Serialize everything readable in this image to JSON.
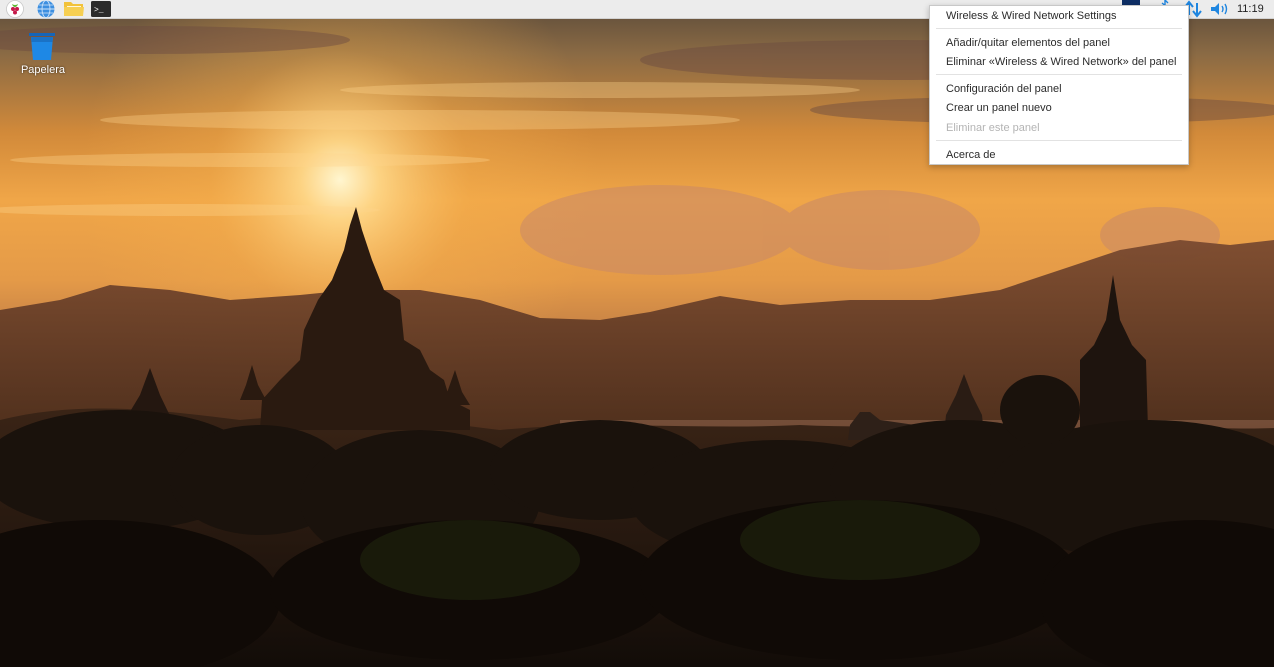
{
  "desktop": {
    "trash_label": "Papelera"
  },
  "taskbar": {
    "launchers": [
      "raspberry-menu-icon",
      "web-browser-icon",
      "file-manager-icon",
      "terminal-icon"
    ],
    "tray": [
      "bluetooth-icon",
      "network-arrows-icon",
      "volume-icon"
    ],
    "clock": "11:19"
  },
  "context_menu": {
    "items": [
      {
        "label": "Wireless & Wired Network Settings",
        "enabled": true
      },
      {
        "label": "Añadir/quitar elementos del panel",
        "enabled": true
      },
      {
        "label": "Eliminar «Wireless & Wired Network» del panel",
        "enabled": true
      },
      {
        "label": "Configuración del panel",
        "enabled": true
      },
      {
        "label": "Crear un panel nuevo",
        "enabled": true
      },
      {
        "label": "Eliminar este panel",
        "enabled": false
      },
      {
        "label": "Acerca de",
        "enabled": true
      }
    ]
  },
  "colors": {
    "panel_bg": "#ececec",
    "menu_bg": "#ffffff",
    "menu_text": "#2b2b2b",
    "menu_disabled": "#b4b4b4",
    "accent_blue": "#1f86e0"
  }
}
